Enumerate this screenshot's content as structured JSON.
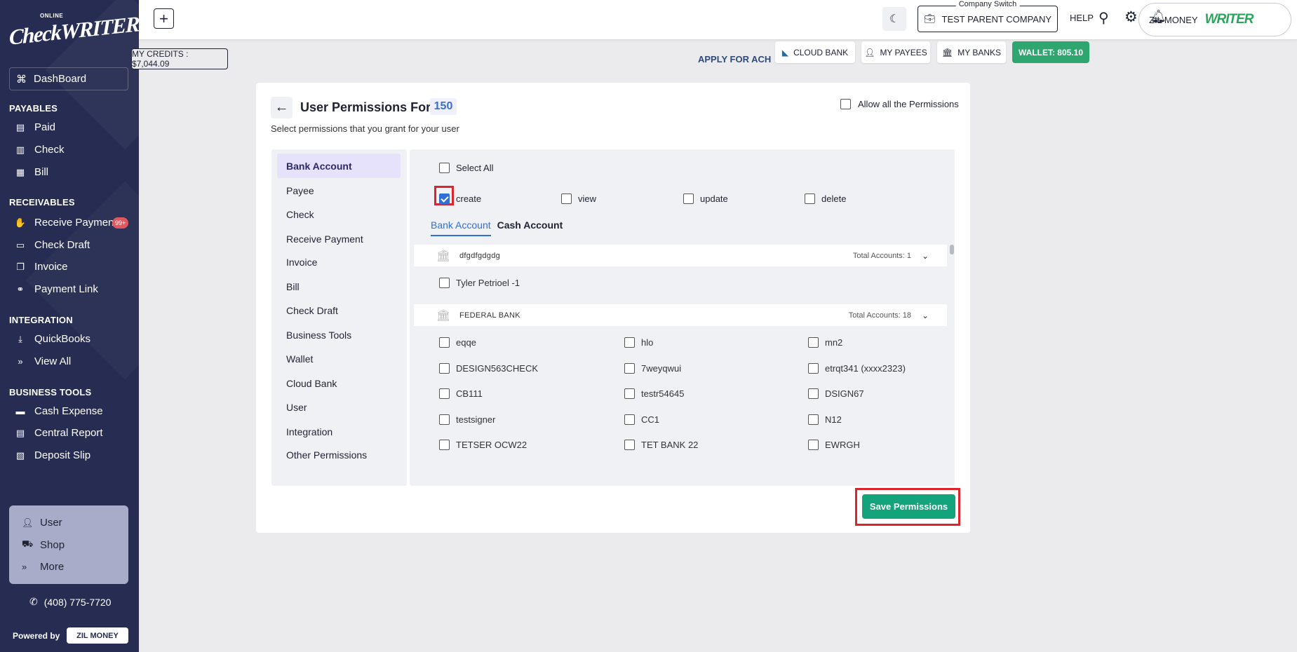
{
  "sidebar": {
    "logo_online": "ONLINE",
    "logo_name": "CheckWRITER",
    "dashboard": "DashBoard",
    "sections": [
      {
        "title": "PAYABLES",
        "items": [
          "Paid",
          "Check",
          "Bill"
        ]
      },
      {
        "title": "RECEIVABLES",
        "items": [
          "Receive Payment",
          "Check Draft",
          "Invoice",
          "Payment Link"
        ]
      },
      {
        "title": "INTEGRATION",
        "items": [
          "QuickBooks",
          "View All"
        ]
      },
      {
        "title": "BUSINESS TOOLS",
        "items": [
          "Cash Expense",
          "Central Report",
          "Deposit Slip"
        ]
      }
    ],
    "badge": "99+",
    "bottom": [
      "User",
      "Shop",
      "More"
    ],
    "phone": "(408) 775-7720",
    "powered_by": "Powered by",
    "zil_money": "ZIL MONEY"
  },
  "topbar": {
    "company_legend": "Company Switch",
    "company": "TEST PARENT COMPANY",
    "help": "HELP",
    "user_name": "ZIL MONEY",
    "user_brand": "WRITER"
  },
  "actions": {
    "credits": "MY CREDITS : $7,044.09",
    "apply_ach": "APPLY FOR ACH",
    "cloud_bank": "CLOUD BANK",
    "my_payees": "MY PAYEES",
    "my_banks": "MY BANKS",
    "wallet": "WALLET: 805.10"
  },
  "card": {
    "title": "User Permissions For",
    "user_id": "150",
    "subtitle": "Select permissions that you grant for your user",
    "allow_all": "Allow all the Permissions",
    "categories": [
      "Bank Account",
      "Payee",
      "Check",
      "Receive Payment",
      "Invoice",
      "Bill",
      "Check Draft",
      "Business Tools",
      "Wallet",
      "Cloud Bank",
      "User",
      "Integration",
      "Other Permissions"
    ],
    "select_all": "Select All",
    "perms": {
      "create": "create",
      "view": "view",
      "update": "update",
      "delete": "delete"
    },
    "tabs": [
      "Bank Account",
      "Cash Account"
    ],
    "banks": [
      {
        "name": "dfgdfgdgdg",
        "total": "Total Accounts: 1",
        "accounts": [
          "Tyler Petrioel -1"
        ]
      },
      {
        "name": "FEDERAL BANK",
        "total": "Total Accounts: 18",
        "accounts": [
          "eqqe",
          "hlo",
          "mn2",
          "DESIGN563CHECK",
          "7weyqwui",
          "etrqt341 (xxxx2323)",
          "CB111",
          "testr54645",
          "DSIGN67",
          "testsigner",
          "CC1",
          "N12",
          "TETSER OCW22",
          "TET BANK 22",
          "EWRGH"
        ]
      }
    ],
    "save": "Save Permissions"
  }
}
